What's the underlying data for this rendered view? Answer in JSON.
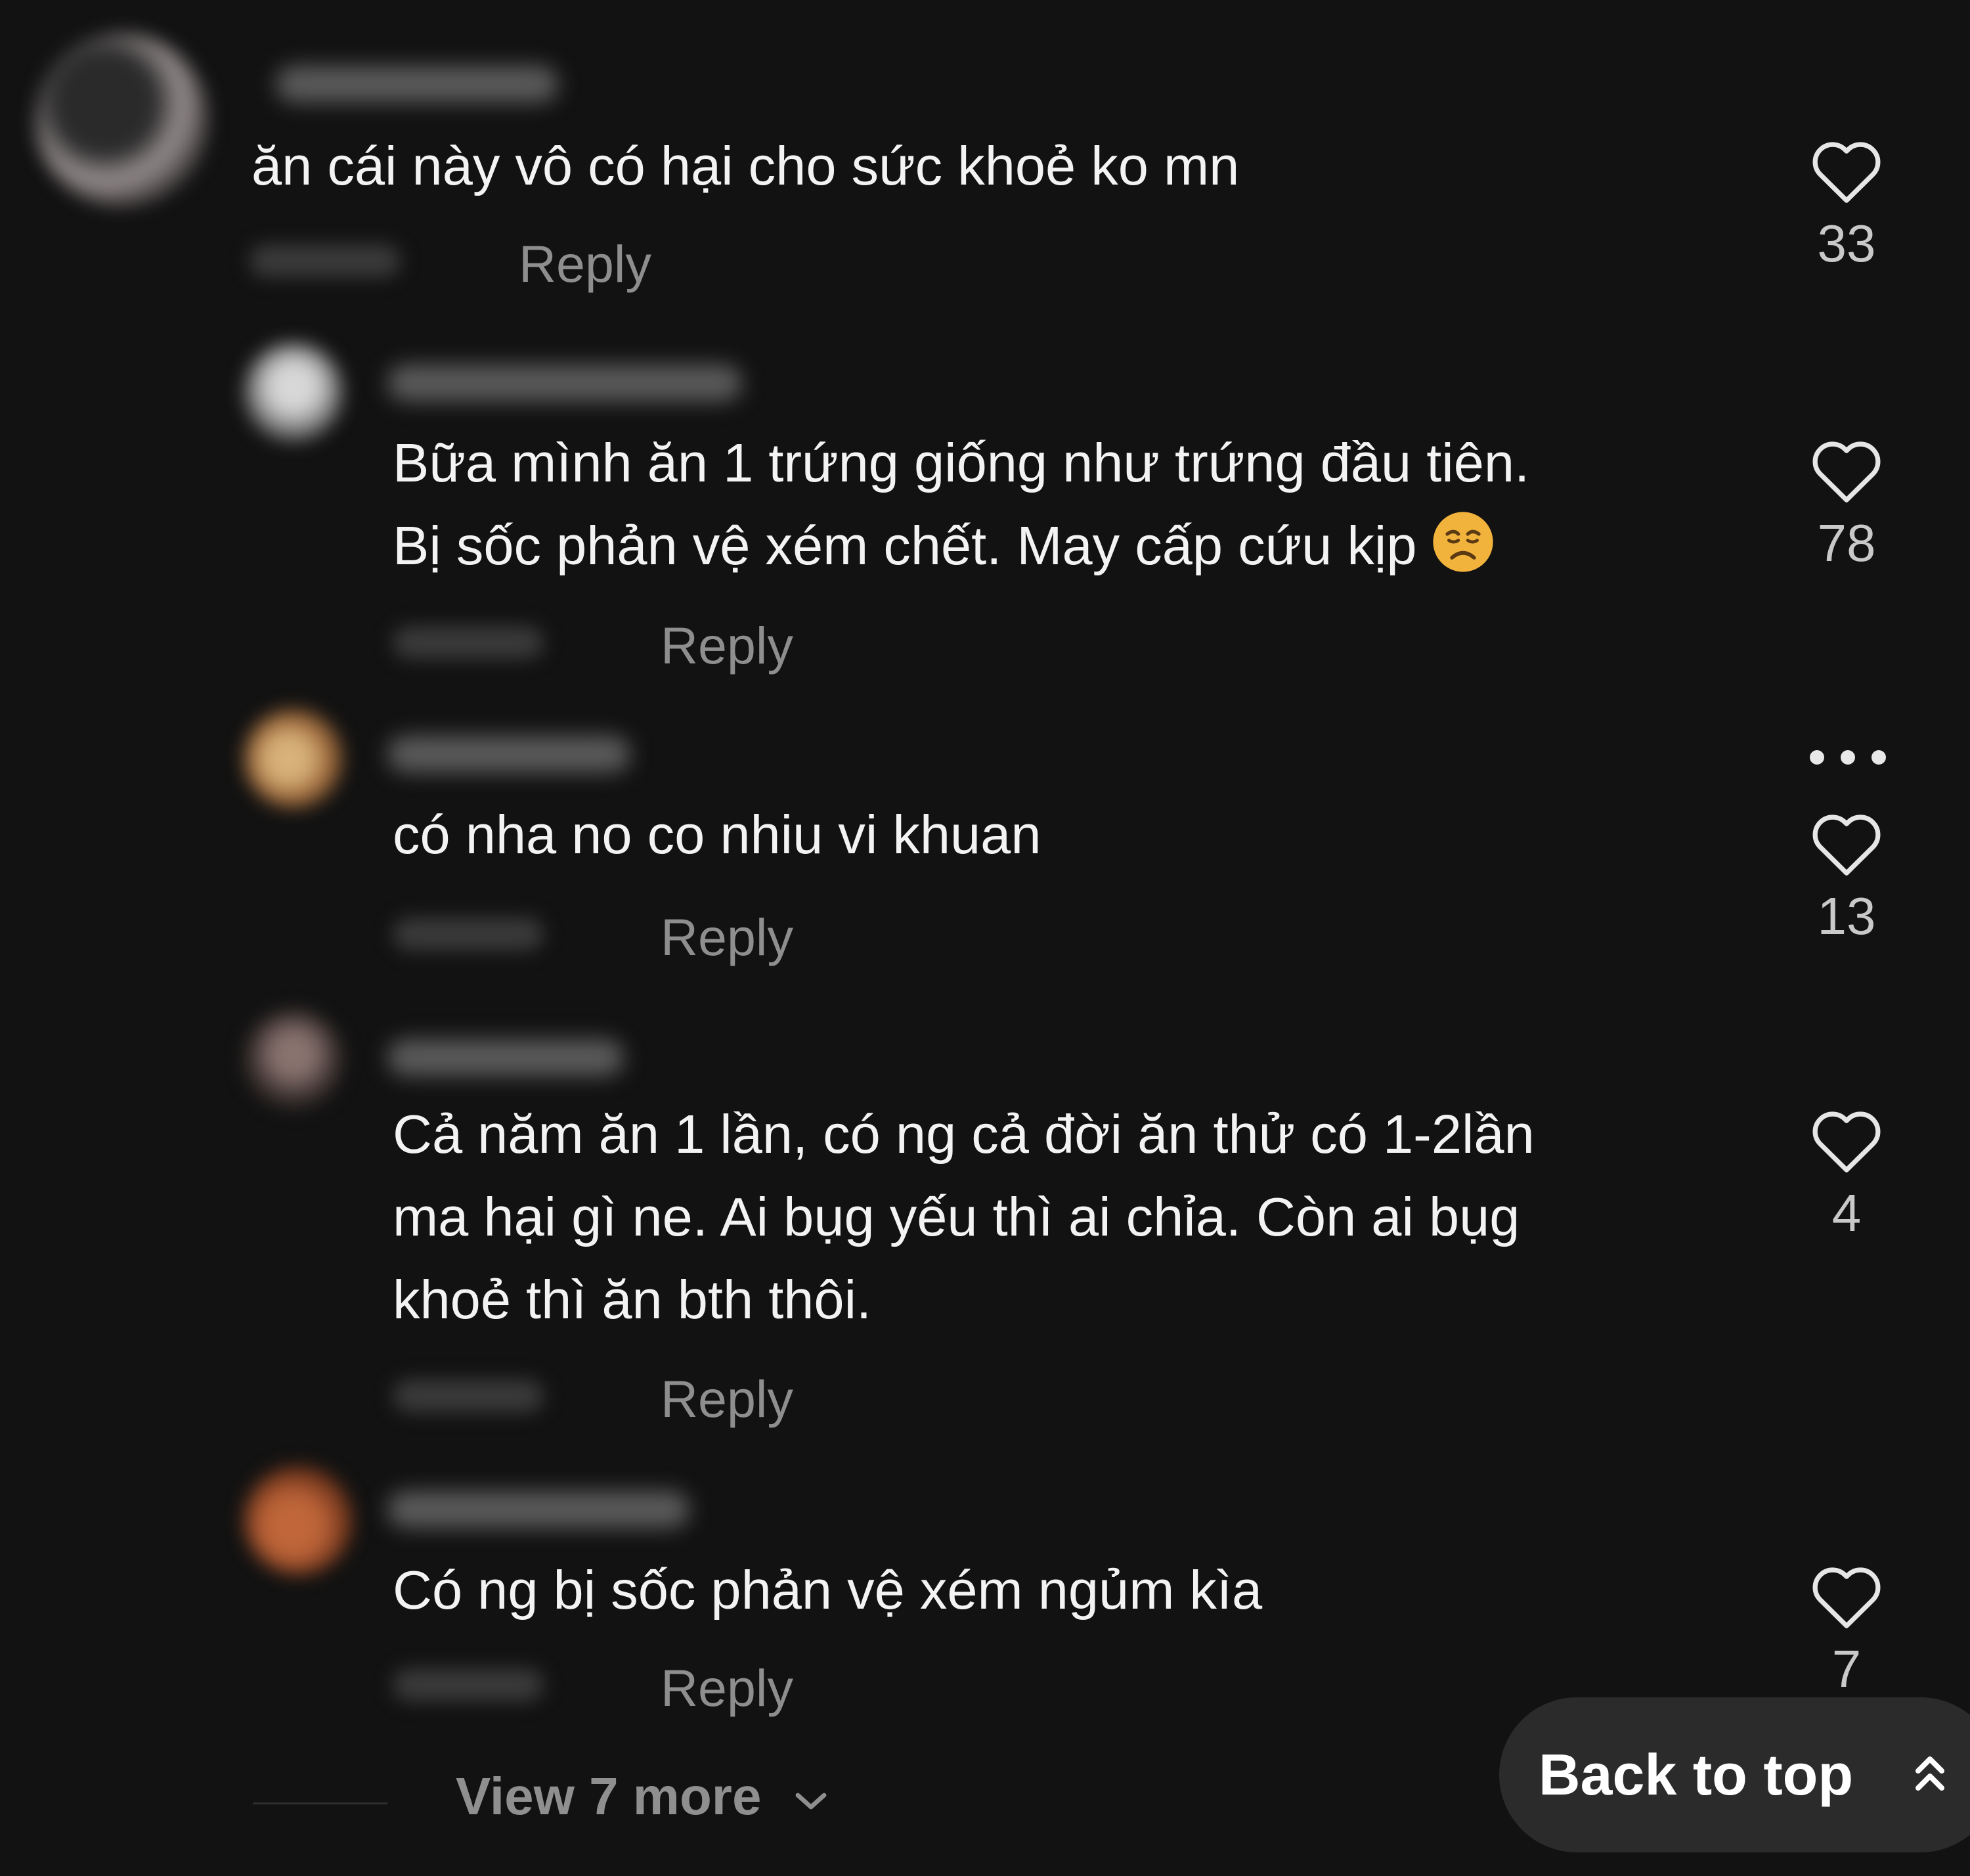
{
  "comments": [
    {
      "text": "ăn cái này vô có hại cho sức khoẻ ko mn",
      "reply_label": "Reply",
      "like_count": "33"
    },
    {
      "text": "Bữa mình ăn 1 trứng giống như trứng đầu tiên.\nBị sốc phản vệ xém chết. May cấp cứu kịp",
      "emoji_icon": "weary-face-emoji",
      "reply_label": "Reply",
      "like_count": "78"
    },
    {
      "text": "có nha no co nhiu vi khuan",
      "reply_label": "Reply",
      "like_count": "13"
    },
    {
      "text": "Cả năm ăn 1 lần, có ng cả đời ăn thử có 1-2lần\nma hại gì ne. Ai bụg yếu thì ai chỉa. Còn ai bụg\nkhoẻ thì ăn bth thôi.",
      "reply_label": "Reply",
      "like_count": "4"
    },
    {
      "text": "Có ng bị sốc phản vệ xém ngủm kìa",
      "reply_label": "Reply",
      "like_count": "7"
    }
  ],
  "view_more": {
    "label": "View 7 more",
    "icon": "chevron-down-icon"
  },
  "back_to_top": {
    "label": "Back to top",
    "icon": "double-chevron-up-icon"
  },
  "icons": {
    "like": "heart-outline-icon",
    "more": "more-options-icon"
  },
  "colors": {
    "background": "#121212",
    "text": "#f3f3f3",
    "muted": "#8e8e8e",
    "pill": "#2b2b2b"
  }
}
